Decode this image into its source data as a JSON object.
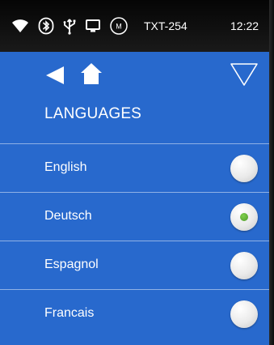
{
  "status_bar": {
    "device_name": "TXT-254",
    "time": "12:22",
    "icons": [
      "wifi-icon",
      "bluetooth-icon",
      "usb-icon",
      "display-icon",
      "m-circle-icon"
    ],
    "m_badge": "M"
  },
  "header": {
    "title": "LANGUAGES",
    "back_icon": "back-arrow-icon",
    "home_icon": "home-icon",
    "menu_icon": "triangle-down-icon"
  },
  "languages": [
    {
      "label": "English",
      "selected": false
    },
    {
      "label": "Deutsch",
      "selected": true
    },
    {
      "label": "Espagnol",
      "selected": false
    },
    {
      "label": "Francais",
      "selected": false
    }
  ],
  "colors": {
    "panel_blue": "#2869cd",
    "divider": "#8fb1e6",
    "selected_dot": "#5aad33"
  }
}
